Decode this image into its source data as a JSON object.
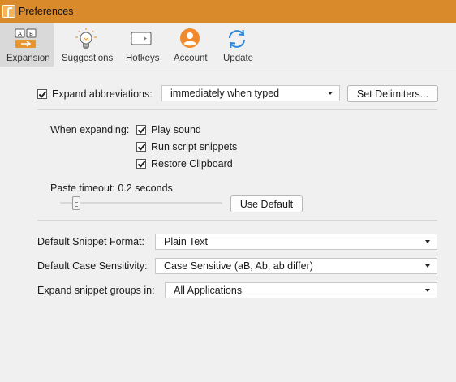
{
  "window": {
    "title": "Preferences",
    "accent": "#d98a2b"
  },
  "toolbar": {
    "tabs": [
      {
        "label": "Expansion",
        "icon": "expansion-ab-icon",
        "active": true
      },
      {
        "label": "Suggestions",
        "icon": "lightbulb-icon",
        "active": false
      },
      {
        "label": "Hotkeys",
        "icon": "hotkeys-icon",
        "active": false
      },
      {
        "label": "Account",
        "icon": "account-icon",
        "active": false
      },
      {
        "label": "Update",
        "icon": "update-icon",
        "active": false
      }
    ],
    "expansion_icon_keys": [
      "A",
      "B"
    ]
  },
  "expansion": {
    "expand_abbreviations": {
      "label": "Expand abbreviations:",
      "checked": true,
      "value": "immediately when typed"
    },
    "set_delimiters_label": "Set Delimiters...",
    "when_expanding_label": "When expanding:",
    "options": [
      {
        "label": "Play sound",
        "checked": true
      },
      {
        "label": "Run script snippets",
        "checked": true
      },
      {
        "label": "Restore Clipboard",
        "checked": true
      }
    ],
    "paste_timeout": {
      "label": "Paste timeout: 0.2 seconds",
      "slider_fraction": 0.1
    },
    "use_default_label": "Use Default"
  },
  "defaults": {
    "snippet_format": {
      "label": "Default Snippet Format:",
      "value": "Plain Text"
    },
    "case_sensitivity": {
      "label": "Default Case Sensitivity:",
      "value": "Case Sensitive (aB, Ab, ab differ)"
    },
    "expand_groups_in": {
      "label": "Expand snippet groups in:",
      "value": "All Applications"
    }
  }
}
